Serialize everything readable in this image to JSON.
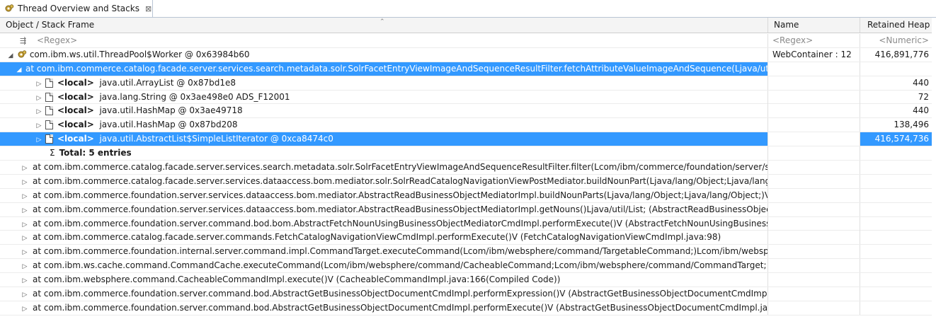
{
  "tab": {
    "title": "Thread Overview and Stacks",
    "close": "⊠",
    "icon": "thread-gear-icon"
  },
  "columns": {
    "frame": "Object / Stack Frame",
    "name": "Name",
    "heap": "Retained Heap"
  },
  "filter": {
    "frame": "<Regex>",
    "name": "<Regex>",
    "heap": "<Numeric>"
  },
  "thread": {
    "label": "com.ibm.ws.util.ThreadPool$Worker @ 0x63984b60",
    "name": "WebContainer : 12",
    "heap": "416,891,776"
  },
  "selected_frame": "at com.ibm.commerce.catalog.facade.server.services.search.metadata.solr.SolrFacetEntryViewImageAndSequenceResultFilter.fetchAttributeValueImageAndSequence(Ljava/util/List",
  "locals": [
    {
      "tag": "<local>",
      "text": "java.util.ArrayList @ 0x87bd1e8",
      "heap": "440"
    },
    {
      "tag": "<local>",
      "text": "java.lang.String @ 0x3ae498e0  ADS_F12001",
      "heap": "72"
    },
    {
      "tag": "<local>",
      "text": "java.util.HashMap @ 0x3ae49718",
      "heap": "440"
    },
    {
      "tag": "<local>",
      "text": "java.util.HashMap @ 0x87bd208",
      "heap": "138,496"
    },
    {
      "tag": "<local>",
      "text": "java.util.AbstractList$SimpleListIterator @ 0xca8474c0",
      "heap": "416,574,736"
    }
  ],
  "total": {
    "sigma": "Σ",
    "label": "Total: 5 entries"
  },
  "frames": [
    "at com.ibm.commerce.catalog.facade.server.services.search.metadata.solr.SolrFacetEntryViewImageAndSequenceResultFilter.filter(Lcom/ibm/commerce/foundation/server/service",
    "at com.ibm.commerce.catalog.facade.server.services.dataaccess.bom.mediator.solr.SolrReadCatalogNavigationViewPostMediator.buildNounPart(Ljava/lang/Object;Ljava/lang/Ob",
    "at com.ibm.commerce.foundation.server.services.dataaccess.bom.mediator.AbstractReadBusinessObjectMediatorImpl.buildNounParts(Ljava/lang/Object;Ljava/lang/Object;)V (Ab",
    "at com.ibm.commerce.foundation.server.services.dataaccess.bom.mediator.AbstractReadBusinessObjectMediatorImpl.getNouns()Ljava/util/List; (AbstractReadBusinessObjectMed",
    "at com.ibm.commerce.foundation.server.command.bod.bom.AbstractFetchNounUsingBusinessObjectMediatorCmdImpl.performExecute()V (AbstractFetchNounUsingBusinessObj",
    "at com.ibm.commerce.catalog.facade.server.commands.FetchCatalogNavigationViewCmdImpl.performExecute()V (FetchCatalogNavigationViewCmdImpl.java:98)",
    "at com.ibm.commerce.foundation.internal.server.command.impl.CommandTarget.executeCommand(Lcom/ibm/websphere/command/TargetableCommand;)Lcom/ibm/websph",
    "at com.ibm.ws.cache.command.CommandCache.executeCommand(Lcom/ibm/websphere/command/CacheableCommand;Lcom/ibm/websphere/command/CommandTarget;",
    "at com.ibm.websphere.command.CacheableCommandImpl.execute()V (CacheableCommandImpl.java:166(Compiled Code))",
    "at com.ibm.commerce.foundation.server.command.bod.AbstractGetBusinessObjectDocumentCmdImpl.performExpression()V (AbstractGetBusinessObjectDocumentCmdImpl.java",
    "at com.ibm.commerce.foundation.server.command.bod.AbstractGetBusinessObjectDocumentCmdImpl.performExecute()V (AbstractGetBusinessObjectDocumentCmdImpl.java:15"
  ],
  "colors": {
    "selection": "#3399ff",
    "header_bg": "#f4f4f4"
  }
}
